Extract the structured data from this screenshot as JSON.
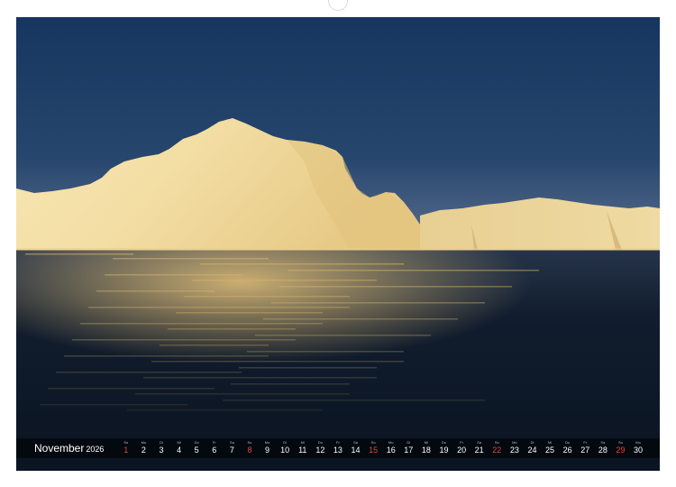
{
  "calendar": {
    "month": "November",
    "year": "2026",
    "days": [
      {
        "n": "1",
        "wd": "So",
        "sun": true
      },
      {
        "n": "2",
        "wd": "Mo",
        "sun": false
      },
      {
        "n": "3",
        "wd": "Di",
        "sun": false
      },
      {
        "n": "4",
        "wd": "Mi",
        "sun": false
      },
      {
        "n": "5",
        "wd": "Do",
        "sun": false
      },
      {
        "n": "6",
        "wd": "Fr",
        "sun": false
      },
      {
        "n": "7",
        "wd": "Sa",
        "sun": false
      },
      {
        "n": "8",
        "wd": "So",
        "sun": true
      },
      {
        "n": "9",
        "wd": "Mo",
        "sun": false
      },
      {
        "n": "10",
        "wd": "Di",
        "sun": false
      },
      {
        "n": "11",
        "wd": "Mi",
        "sun": false
      },
      {
        "n": "12",
        "wd": "Do",
        "sun": false
      },
      {
        "n": "13",
        "wd": "Fr",
        "sun": false
      },
      {
        "n": "14",
        "wd": "Sa",
        "sun": false
      },
      {
        "n": "15",
        "wd": "So",
        "sun": true
      },
      {
        "n": "16",
        "wd": "Mo",
        "sun": false
      },
      {
        "n": "17",
        "wd": "Di",
        "sun": false
      },
      {
        "n": "18",
        "wd": "Mi",
        "sun": false
      },
      {
        "n": "19",
        "wd": "Do",
        "sun": false
      },
      {
        "n": "20",
        "wd": "Fr",
        "sun": false
      },
      {
        "n": "21",
        "wd": "Sa",
        "sun": false
      },
      {
        "n": "22",
        "wd": "So",
        "sun": true
      },
      {
        "n": "23",
        "wd": "Mo",
        "sun": false
      },
      {
        "n": "24",
        "wd": "Di",
        "sun": false
      },
      {
        "n": "25",
        "wd": "Mi",
        "sun": false
      },
      {
        "n": "26",
        "wd": "Do",
        "sun": false
      },
      {
        "n": "27",
        "wd": "Fr",
        "sun": false
      },
      {
        "n": "28",
        "wd": "Sa",
        "sun": false
      },
      {
        "n": "29",
        "wd": "So",
        "sun": true
      },
      {
        "n": "30",
        "wd": "Mo",
        "sun": false
      }
    ]
  },
  "colors": {
    "sky_top": "#17375f",
    "sky_horizon": "#5a6f8e",
    "ice_light": "#f6e7b6",
    "ice_shadow": "#d9b775",
    "water": "#0d1a2a",
    "sunday": "#e0463a"
  }
}
